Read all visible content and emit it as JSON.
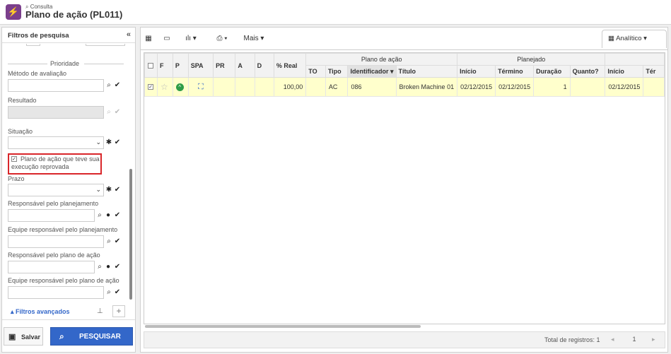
{
  "header": {
    "crumb": "Consulta",
    "title": "Plano de ação (PL011)"
  },
  "filters": {
    "title": "Filtros de pesquisa",
    "section": "Prioridade",
    "metodo_label": "Método de avaliação",
    "resultado_label": "Resultado",
    "situacao_label": "Situação",
    "checkbox_label": "Plano de ação que teve sua execução reprovada",
    "prazo_label": "Prazo",
    "resp_plan_label": "Responsável pelo planejamento",
    "equipe_plan_label": "Equipe responsável pelo planejamento",
    "resp_plano_label": "Responsável pelo plano de ação",
    "equipe_plano_label": "Equipe responsável pelo plano de ação",
    "advanced": "Filtros avançados"
  },
  "buttons": {
    "save": "Salvar",
    "search": "PESQUISAR"
  },
  "toolbar": {
    "more": "Mais",
    "view": "Analítico"
  },
  "grid": {
    "group_plano": "Plano de ação",
    "group_planejado": "Planejado",
    "cols": {
      "f": "F",
      "p": "P",
      "spa": "SPA",
      "pr": "PR",
      "a": "A",
      "d": "D",
      "real": "% Real",
      "to": "TO",
      "tipo": "Tipo",
      "id": "Identificador",
      "titulo": "Título",
      "inicio": "Início",
      "termino": "Término",
      "duracao": "Duração",
      "quanto": "Quanto?",
      "inicio2": "Início",
      "ter2": "Tér"
    },
    "row": {
      "real": "100,00",
      "tipo": "AC",
      "id": "086",
      "titulo": "Broken Machine 01",
      "inicio": "02/12/2015",
      "termino": "02/12/2015",
      "duracao": "1",
      "inicio2": "02/12/2015"
    }
  },
  "footer": {
    "total": "Total de registros: 1",
    "page": "1"
  },
  "colors": {
    "accent": "#3367c9",
    "brand": "#7b3f8c",
    "highlight": "#d9262a",
    "selected_row": "#ffffcc",
    "status_ok": "#2e9c47"
  }
}
